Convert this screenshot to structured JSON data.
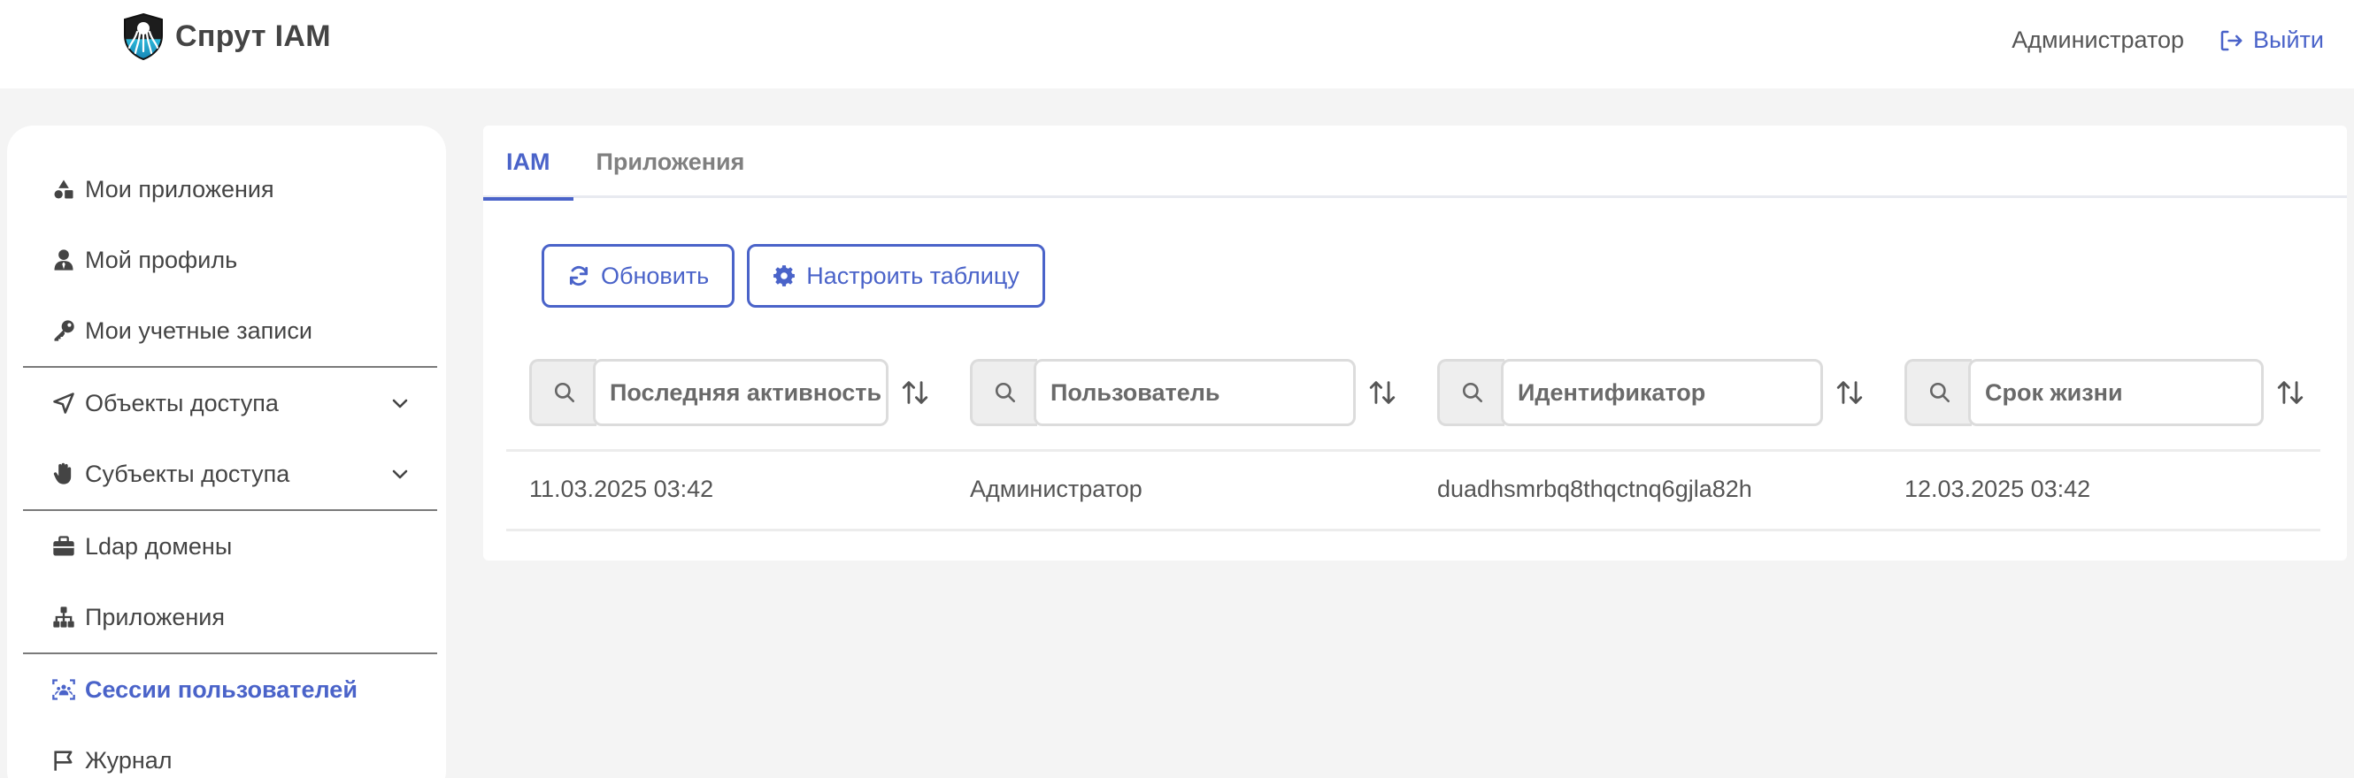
{
  "app": {
    "brand": "Спрут IAM"
  },
  "header": {
    "user": "Администратор",
    "logout": "Выйти"
  },
  "sidebar": {
    "items": [
      {
        "label": "Мои приложения",
        "icon": "shapes-icon"
      },
      {
        "label": "Мой профиль",
        "icon": "user-tie-icon"
      },
      {
        "label": "Мои учетные записи",
        "icon": "key-icon"
      },
      {
        "label": "Объекты доступа",
        "icon": "location-arrow-icon",
        "expandable": true
      },
      {
        "label": "Субъекты доступа",
        "icon": "hand-icon",
        "expandable": true
      },
      {
        "label": "Ldap домены",
        "icon": "briefcase-icon"
      },
      {
        "label": "Приложения",
        "icon": "sitemap-icon"
      },
      {
        "label": "Сессии пользователей",
        "icon": "users-scan-icon",
        "active": true
      },
      {
        "label": "Журнал",
        "icon": "flag-icon"
      }
    ]
  },
  "tabs": [
    {
      "label": "IAM",
      "active": true
    },
    {
      "label": "Приложения",
      "active": false
    }
  ],
  "toolbar": {
    "refresh": "Обновить",
    "configure": "Настроить таблицу"
  },
  "filters": [
    {
      "placeholder": "Последняя активность"
    },
    {
      "placeholder": "Пользователь"
    },
    {
      "placeholder": "Идентификатор"
    },
    {
      "placeholder": "Срок жизни"
    }
  ],
  "rows": [
    {
      "last_activity": "11.03.2025 03:42",
      "user": "Администратор",
      "id": "duadhsmrbq8thqctnq6gjla82h",
      "lifetime": "12.03.2025 03:42"
    }
  ],
  "colors": {
    "accent": "#4a63c9",
    "background": "#f4f4f4",
    "panel": "#ffffff"
  }
}
